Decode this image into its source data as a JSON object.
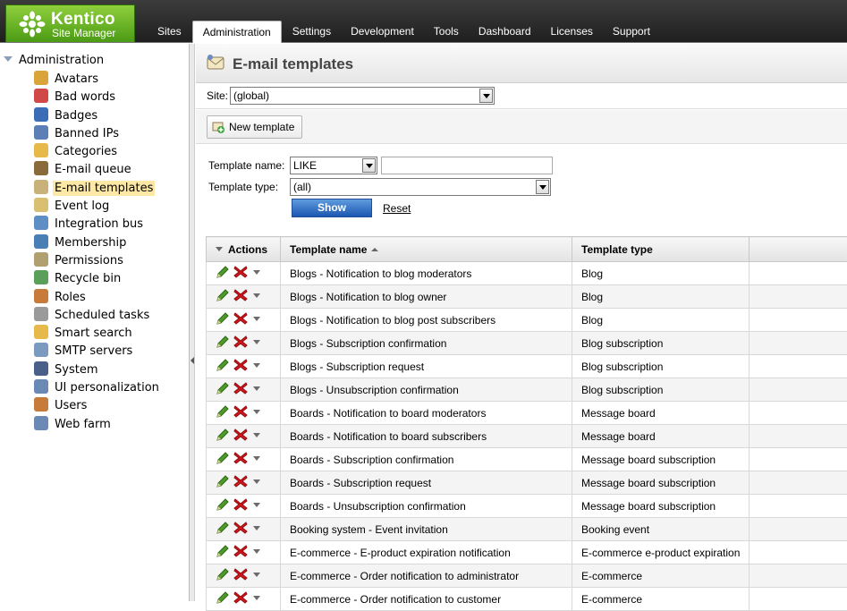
{
  "app": {
    "brand": "Kentico",
    "subtitle": "Site Manager"
  },
  "nav": {
    "tabs": [
      {
        "label": "Sites",
        "active": false
      },
      {
        "label": "Administration",
        "active": true
      },
      {
        "label": "Settings",
        "active": false
      },
      {
        "label": "Development",
        "active": false
      },
      {
        "label": "Tools",
        "active": false
      },
      {
        "label": "Dashboard",
        "active": false
      },
      {
        "label": "Licenses",
        "active": false
      },
      {
        "label": "Support",
        "active": false
      }
    ]
  },
  "tree": {
    "root": "Administration",
    "items": [
      {
        "label": "Avatars",
        "icon": "avatar-icon",
        "color": "#d9a43a"
      },
      {
        "label": "Bad words",
        "icon": "bad-words-icon",
        "color": "#d04848"
      },
      {
        "label": "Badges",
        "icon": "badge-icon",
        "color": "#3a6db5"
      },
      {
        "label": "Banned IPs",
        "icon": "banned-ip-icon",
        "color": "#5d7fb5"
      },
      {
        "label": "Categories",
        "icon": "folder-icon",
        "color": "#e6b94a"
      },
      {
        "label": "E-mail queue",
        "icon": "email-queue-icon",
        "color": "#8a6a3a"
      },
      {
        "label": "E-mail templates",
        "icon": "email-template-icon",
        "color": "#c9b27a",
        "selected": true
      },
      {
        "label": "Event log",
        "icon": "event-log-icon",
        "color": "#d9c070"
      },
      {
        "label": "Integration bus",
        "icon": "integration-bus-icon",
        "color": "#5d8fc5"
      },
      {
        "label": "Membership",
        "icon": "membership-icon",
        "color": "#4a7fb5"
      },
      {
        "label": "Permissions",
        "icon": "key-icon",
        "color": "#b0a070"
      },
      {
        "label": "Recycle bin",
        "icon": "recycle-bin-icon",
        "color": "#5aa05a"
      },
      {
        "label": "Roles",
        "icon": "roles-icon",
        "color": "#c87a3a"
      },
      {
        "label": "Scheduled tasks",
        "icon": "clock-icon",
        "color": "#9a9a9a"
      },
      {
        "label": "Smart search",
        "icon": "smart-search-icon",
        "color": "#e6b94a"
      },
      {
        "label": "SMTP servers",
        "icon": "smtp-server-icon",
        "color": "#7a9ac0"
      },
      {
        "label": "System",
        "icon": "system-icon",
        "color": "#4a5f8a"
      },
      {
        "label": "UI personalization",
        "icon": "ui-personalization-icon",
        "color": "#6a8ab5"
      },
      {
        "label": "Users",
        "icon": "user-icon",
        "color": "#c87a3a"
      },
      {
        "label": "Web farm",
        "icon": "web-farm-icon",
        "color": "#6a8ab5"
      }
    ]
  },
  "page": {
    "title": "E-mail templates",
    "site_label": "Site:",
    "site_value": "(global)",
    "new_button": "New template",
    "filter": {
      "name_label": "Template name:",
      "name_operator": "LIKE",
      "name_value": "",
      "type_label": "Template type:",
      "type_value": "(all)",
      "show_button": "Show",
      "reset_link": "Reset"
    }
  },
  "grid": {
    "headers": {
      "actions": "Actions",
      "name": "Template name",
      "type": "Template type"
    },
    "rows": [
      {
        "name": "Blogs - Notification to blog moderators",
        "type": "Blog"
      },
      {
        "name": "Blogs - Notification to blog owner",
        "type": "Blog"
      },
      {
        "name": "Blogs - Notification to blog post subscribers",
        "type": "Blog"
      },
      {
        "name": "Blogs - Subscription confirmation",
        "type": "Blog subscription"
      },
      {
        "name": "Blogs - Subscription request",
        "type": "Blog subscription"
      },
      {
        "name": "Blogs - Unsubscription confirmation",
        "type": "Blog subscription"
      },
      {
        "name": "Boards - Notification to board moderators",
        "type": "Message board"
      },
      {
        "name": "Boards - Notification to board subscribers",
        "type": "Message board"
      },
      {
        "name": "Boards - Subscription confirmation",
        "type": "Message board subscription"
      },
      {
        "name": "Boards - Subscription request",
        "type": "Message board subscription"
      },
      {
        "name": "Boards - Unsubscription confirmation",
        "type": "Message board subscription"
      },
      {
        "name": "Booking system - Event invitation",
        "type": "Booking event"
      },
      {
        "name": "E-commerce - E-product expiration notification",
        "type": "E-commerce e-product expiration"
      },
      {
        "name": "E-commerce - Order notification to administrator",
        "type": "E-commerce"
      },
      {
        "name": "E-commerce - Order notification to customer",
        "type": "E-commerce"
      }
    ]
  }
}
